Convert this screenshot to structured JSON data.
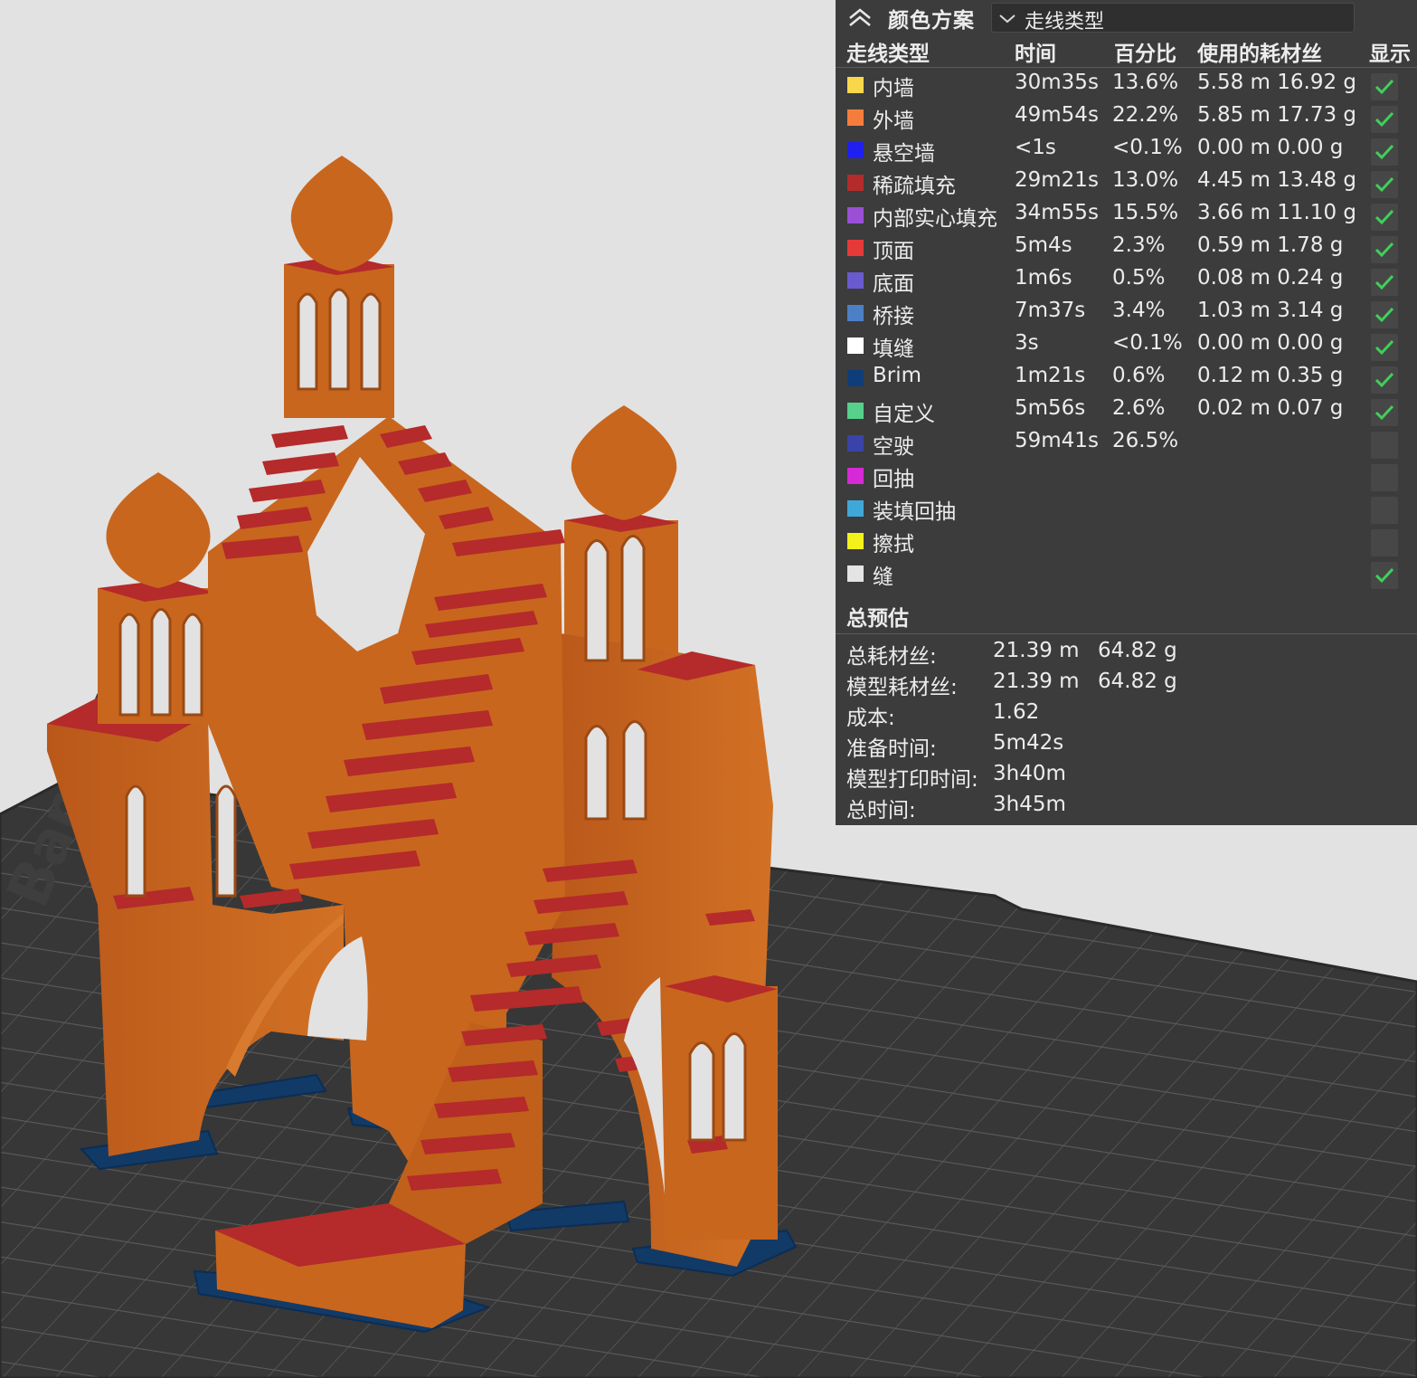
{
  "panel": {
    "title": "颜色方案",
    "scheme_value": "走线类型",
    "headers": {
      "type": "走线类型",
      "time": "时间",
      "percent": "百分比",
      "filament": "使用的耗材丝",
      "show": "显示"
    },
    "rows": [
      {
        "color": "#f8d74a",
        "name": "内墙",
        "time": "30m35s",
        "percent": "13.6%",
        "filament": "5.58 m  16.92 g",
        "shown": true
      },
      {
        "color": "#f47d3b",
        "name": "外墙",
        "time": "49m54s",
        "percent": "22.2%",
        "filament": "5.85 m  17.73 g",
        "shown": true
      },
      {
        "color": "#1f1ff0",
        "name": "悬空墙",
        "time": "<1s",
        "percent": "<0.1%",
        "filament": "0.00 m  0.00 g",
        "shown": true
      },
      {
        "color": "#b32b2b",
        "name": "稀疏填充",
        "time": "29m21s",
        "percent": "13.0%",
        "filament": "4.45 m  13.48 g",
        "shown": true
      },
      {
        "color": "#9a4fd6",
        "name": "内部实心填充",
        "time": "34m55s",
        "percent": "15.5%",
        "filament": "3.66 m  11.10 g",
        "shown": true
      },
      {
        "color": "#e63a3a",
        "name": "顶面",
        "time": "5m4s",
        "percent": "2.3%",
        "filament": "0.59 m  1.78 g",
        "shown": true
      },
      {
        "color": "#6a5acf",
        "name": "底面",
        "time": "1m6s",
        "percent": "0.5%",
        "filament": "0.08 m  0.24 g",
        "shown": true
      },
      {
        "color": "#4d7fc6",
        "name": "桥接",
        "time": "7m37s",
        "percent": "3.4%",
        "filament": "1.03 m  3.14 g",
        "shown": true
      },
      {
        "color": "#ffffff",
        "name": "填缝",
        "time": "3s",
        "percent": "<0.1%",
        "filament": "0.00 m  0.00 g",
        "shown": true
      },
      {
        "color": "#0e3d7a",
        "name": "Brim",
        "time": "1m21s",
        "percent": "0.6%",
        "filament": "0.12 m  0.35 g",
        "shown": true
      },
      {
        "color": "#56d08b",
        "name": "自定义",
        "time": "5m56s",
        "percent": "2.6%",
        "filament": "0.02 m  0.07 g",
        "shown": true
      },
      {
        "color": "#3a44a8",
        "name": "空驶",
        "time": "59m41s",
        "percent": "26.5%",
        "filament": "",
        "shown": false
      },
      {
        "color": "#d52ad5",
        "name": "回抽",
        "time": "",
        "percent": "",
        "filament": "",
        "shown": false
      },
      {
        "color": "#40a8d8",
        "name": "装填回抽",
        "time": "",
        "percent": "",
        "filament": "",
        "shown": false
      },
      {
        "color": "#f2f21a",
        "name": "擦拭",
        "time": "",
        "percent": "",
        "filament": "",
        "shown": false
      },
      {
        "color": "#e4e4e4",
        "name": "缝",
        "time": "",
        "percent": "",
        "filament": "",
        "shown": true
      }
    ],
    "summary_title": "总预估",
    "summary": [
      {
        "label": "总耗材丝:",
        "v1": "21.39 m",
        "v2": "64.82 g"
      },
      {
        "label": "模型耗材丝:",
        "v1": "21.39 m",
        "v2": "64.82 g"
      },
      {
        "label": "成本:",
        "v1": "1.62",
        "v2": ""
      },
      {
        "label": "准备时间:",
        "v1": "5m42s",
        "v2": ""
      },
      {
        "label": "模型打印时间:",
        "v1": "3h40m",
        "v2": ""
      },
      {
        "label": "总时间:",
        "v1": "3h45m",
        "v2": ""
      }
    ]
  },
  "viewport": {
    "bed_logo": "Bambu",
    "colors": {
      "background": "#e2e2e2",
      "bed": "#373737",
      "grid": "#555555",
      "model": "#c8661e",
      "top_face": "#b52a2a",
      "brim": "#123a66",
      "accent": "#3fd05a"
    }
  }
}
